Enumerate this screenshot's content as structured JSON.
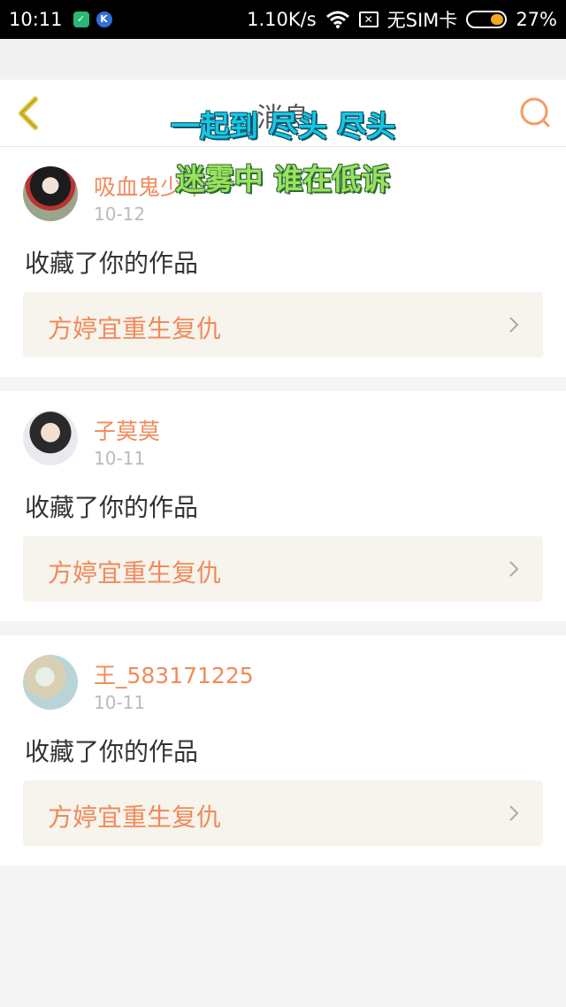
{
  "status_bar": {
    "time": "10:11",
    "network_speed": "1.10K/s",
    "sim": "无SIM卡",
    "battery_percent": "27%",
    "battery_level": 0.27
  },
  "nav": {
    "title": "消息",
    "back_icon": "chevron-left-icon",
    "search_icon": "search-icon"
  },
  "overlay_lyrics": [
    "一起到 尽头 尽头",
    "迷雾中 谁在低诉"
  ],
  "colors": {
    "accent": "#f08a5a",
    "back_icon": "#e0c43b",
    "search_icon": "#f39c62"
  },
  "messages": [
    {
      "user": "吸血鬼少年",
      "date": "10-12",
      "action": "收藏了你的作品",
      "work_title": "方婷宜重生复仇"
    },
    {
      "user": "子莫莫",
      "date": "10-11",
      "action": "收藏了你的作品",
      "work_title": "方婷宜重生复仇"
    },
    {
      "user": "王_583171225",
      "date": "10-11",
      "action": "收藏了你的作品",
      "work_title": "方婷宜重生复仇"
    }
  ]
}
